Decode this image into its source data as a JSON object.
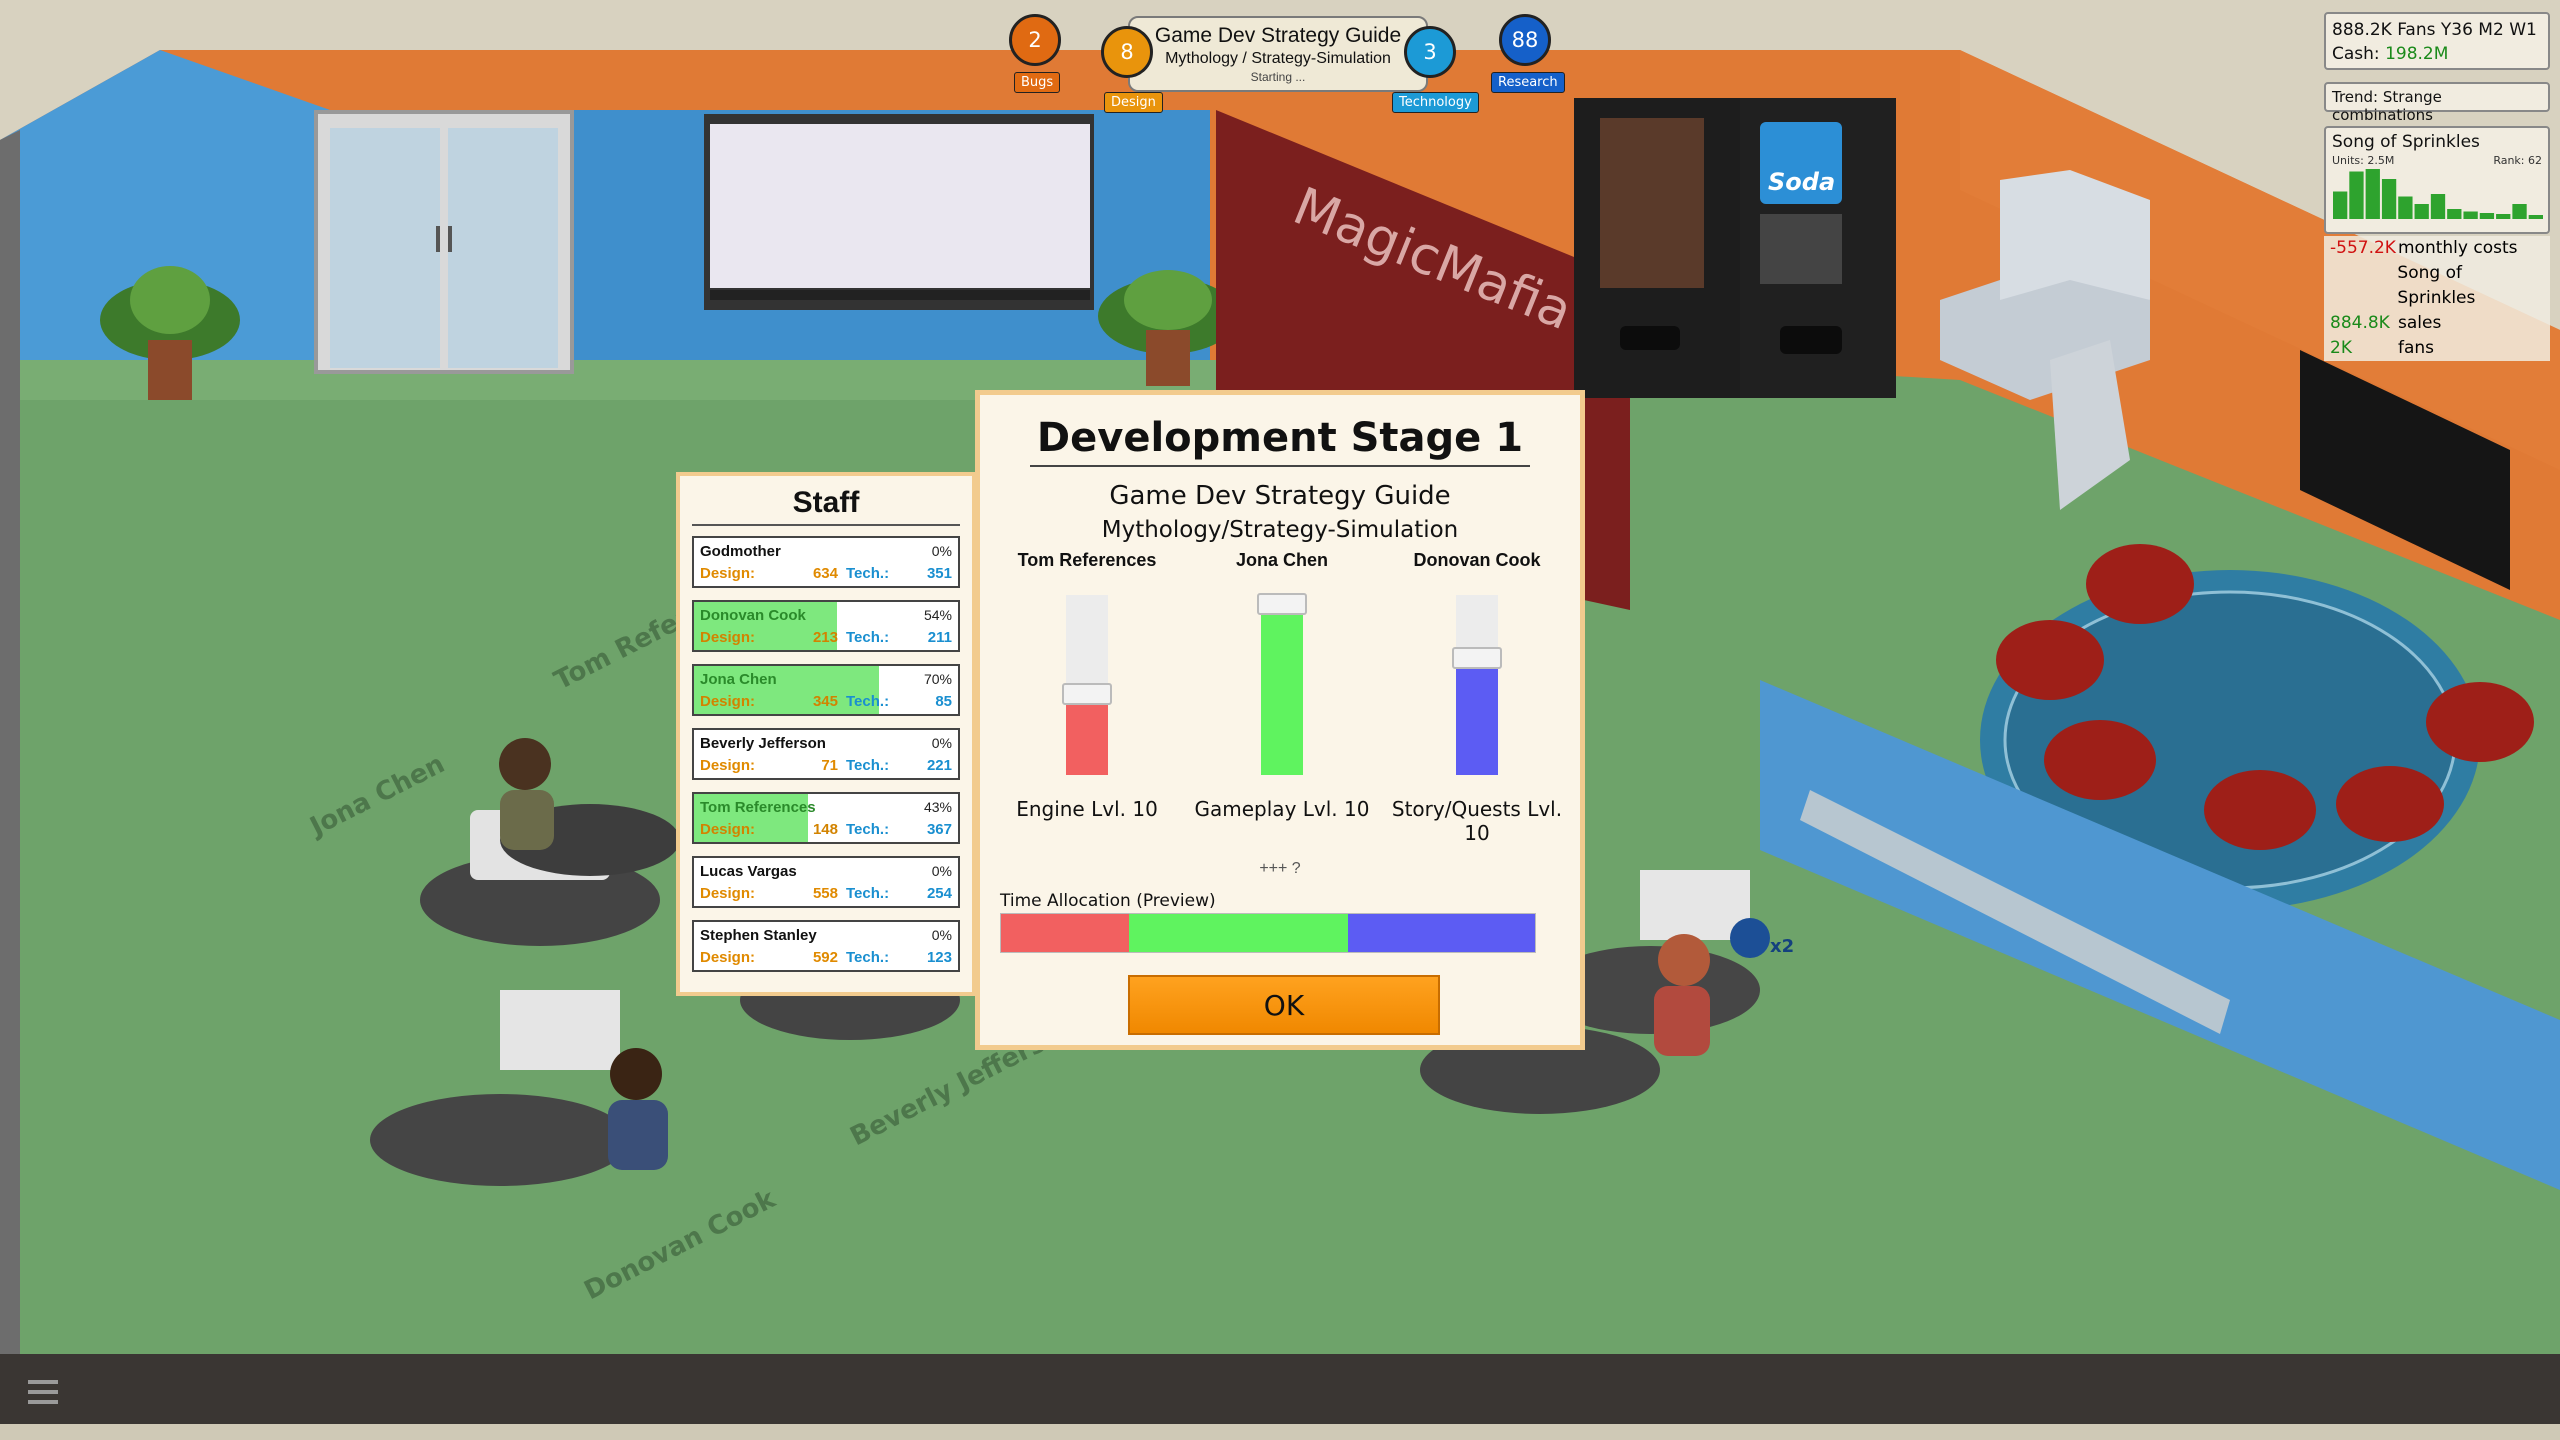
{
  "studio": {
    "wall_sign": "MagicMafia"
  },
  "hud": {
    "bugs": {
      "value": "2",
      "label": "Bugs",
      "color": "#e06a12"
    },
    "design": {
      "value": "8",
      "label": "Design",
      "color": "#e9940c"
    },
    "technology": {
      "value": "3",
      "label": "Technology",
      "color": "#1c9ad6"
    },
    "research": {
      "value": "88",
      "label": "Research",
      "color": "#1560c9"
    },
    "project": {
      "title": "Game Dev Strategy Guide",
      "genre": "Mythology / Strategy-Simulation",
      "status": "Starting ..."
    }
  },
  "info": {
    "fans_line": "888.2K Fans Y36 M2 W1",
    "cash_label": "Cash:",
    "cash_value": "198.2M",
    "trend": "Trend: Strange combinations",
    "game_name": "Song of Sprinkles",
    "units": "Units: 2.5M",
    "rank": "Rank: 62",
    "sales_bars": [
      0.55,
      0.95,
      1.0,
      0.8,
      0.45,
      0.3,
      0.5,
      0.2,
      0.15,
      0.12,
      0.1,
      0.3,
      0.08
    ],
    "costs": [
      {
        "value": "-557.2K",
        "label": "monthly costs",
        "color": "#d01010"
      },
      {
        "value": "",
        "label": "Song of Sprinkles",
        "color": "#111"
      },
      {
        "value": "884.8K",
        "label": "sales",
        "color": "#1a8a1a"
      },
      {
        "value": "2K",
        "label": "fans",
        "color": "#1a8a1a"
      }
    ]
  },
  "staff": {
    "title": "Staff",
    "design_label": "Design:",
    "tech_label": "Tech.:",
    "members": [
      {
        "name": "Godmother",
        "progress": "0%",
        "design": "634",
        "tech": "351",
        "fill": 0
      },
      {
        "name": "Donovan Cook",
        "progress": "54%",
        "design": "213",
        "tech": "211",
        "fill": 0.54
      },
      {
        "name": "Jona Chen",
        "progress": "70%",
        "design": "345",
        "tech": "85",
        "fill": 0.7
      },
      {
        "name": "Beverly Jefferson",
        "progress": "0%",
        "design": "71",
        "tech": "221",
        "fill": 0
      },
      {
        "name": "Tom References",
        "progress": "43%",
        "design": "148",
        "tech": "367",
        "fill": 0.43
      },
      {
        "name": "Lucas Vargas",
        "progress": "0%",
        "design": "558",
        "tech": "254",
        "fill": 0
      },
      {
        "name": "Stephen Stanley",
        "progress": "0%",
        "design": "592",
        "tech": "123",
        "fill": 0
      }
    ]
  },
  "floor_names": [
    "Tom References",
    "Jona Chen",
    "Beverly Jefferson",
    "Donovan Cook"
  ],
  "dev": {
    "title": "Development Stage 1",
    "game": "Game Dev Strategy Guide",
    "genre": "Mythology/Strategy-Simulation",
    "hint": "+++ ?",
    "time_label": "Time Allocation (Preview)",
    "ok": "OK",
    "sliders": [
      {
        "person": "Tom References",
        "area": "Engine Lvl. 10",
        "level": 0.45,
        "color": "#f26060"
      },
      {
        "person": "Jona Chen",
        "area": "Gameplay Lvl. 10",
        "level": 0.95,
        "color": "#5ff35f"
      },
      {
        "person": "Donovan Cook",
        "area": "Story/Quests Lvl. 10",
        "level": 0.65,
        "color": "#5c5cf3"
      }
    ],
    "allocation": [
      0.24,
      0.41,
      0.35
    ]
  },
  "boost": "x2"
}
